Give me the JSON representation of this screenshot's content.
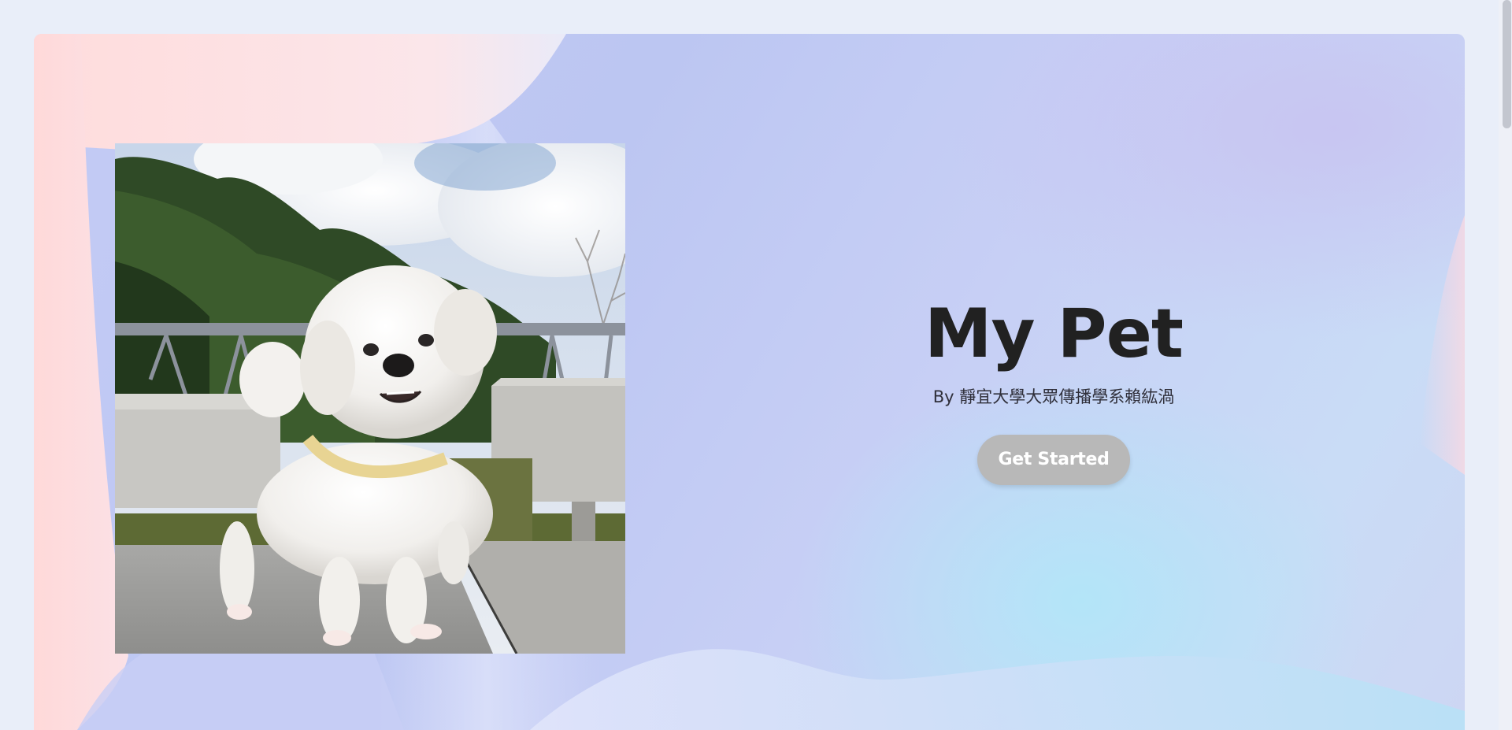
{
  "hero": {
    "title": "My Pet",
    "subtitle": "By 靜宜大學大眾傳播學系賴紘渦",
    "cta_label": "Get Started",
    "image_subject": "white maltese dog on bench outdoors"
  },
  "colors": {
    "title": "#212121",
    "button": "#b8b8b8",
    "button_text": "#ffffff",
    "bg_pink": "#fde0e0",
    "bg_lavender": "#bcc6f2",
    "bg_cyan": "#b2e6f8"
  }
}
